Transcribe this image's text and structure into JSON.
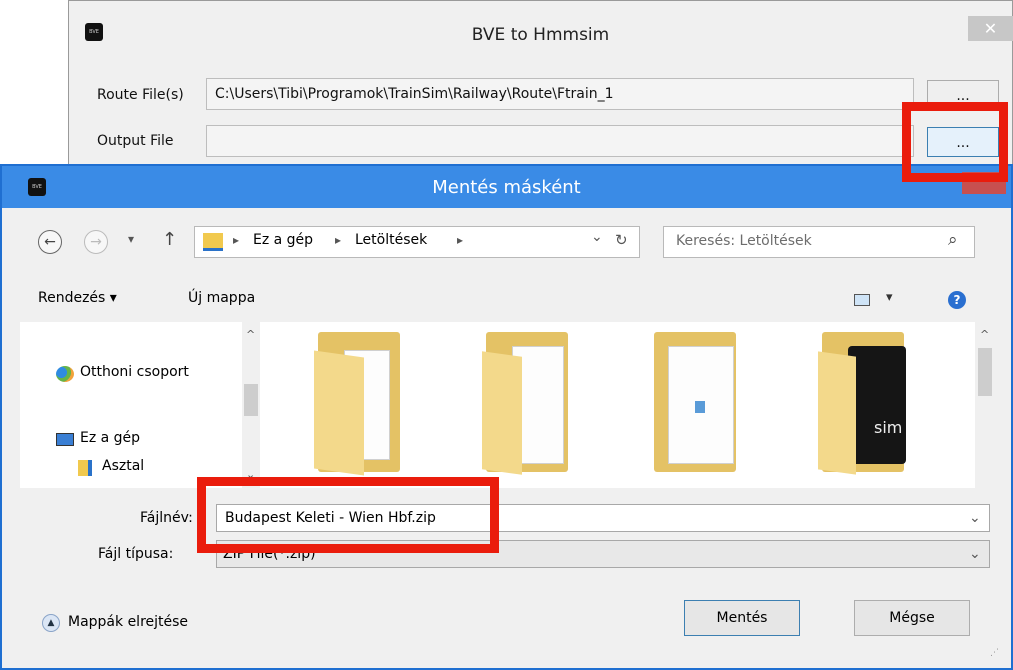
{
  "back_window": {
    "title": "BVE to Hmmsim",
    "close_glyph": "✕",
    "route_label": "Route File(s)",
    "route_value": "C:\\Users\\Tibi\\Programok\\TrainSim\\Railway\\Route\\Ftrain_1",
    "route_browse": "...",
    "output_label": "Output File",
    "output_value": "",
    "output_browse": "..."
  },
  "dialog": {
    "title": "Mentés másként",
    "close_glyph": "⌃",
    "nav": {
      "back_glyph": "←",
      "forward_glyph": "→",
      "recent_glyph": "▾",
      "up_glyph": "↑",
      "breadcrumb": [
        "Ez a gép",
        "Letöltések"
      ],
      "separator": "▸",
      "dropdown_glyph": "⌄",
      "refresh_glyph": "↻",
      "search_placeholder": "Keresés: Letöltések",
      "search_glyph": "⌕"
    },
    "toolbar": {
      "organize": "Rendezés ▾",
      "new_folder": "Új mappa",
      "view_glyph": "▾",
      "help_glyph": "?"
    },
    "sidebar": {
      "items": [
        {
          "label": "Otthoni csoport",
          "icon": "homegroup-icon"
        },
        {
          "label": "Ez a gép",
          "icon": "computer-icon"
        },
        {
          "label": "Asztal",
          "icon": "desktop-folder-icon"
        }
      ]
    },
    "folders": [
      {
        "name": "folder-1"
      },
      {
        "name": "folder-2"
      },
      {
        "name": "folder-3"
      },
      {
        "name": "folder-4",
        "overlay_text": "sim"
      }
    ],
    "filename_label": "Fájlnév:",
    "filename_value": "Budapest Keleti - Wien Hbf.zip",
    "filetype_label": "Fájl típusa:",
    "filetype_value": "ZIP File(*.zip)",
    "hide_folders": "Mappák elrejtése",
    "save_button": "Mentés",
    "cancel_button": "Mégse"
  },
  "colors": {
    "title_active": "#3a8be6",
    "highlight": "#ea1c0c",
    "close_red": "#c75050"
  }
}
